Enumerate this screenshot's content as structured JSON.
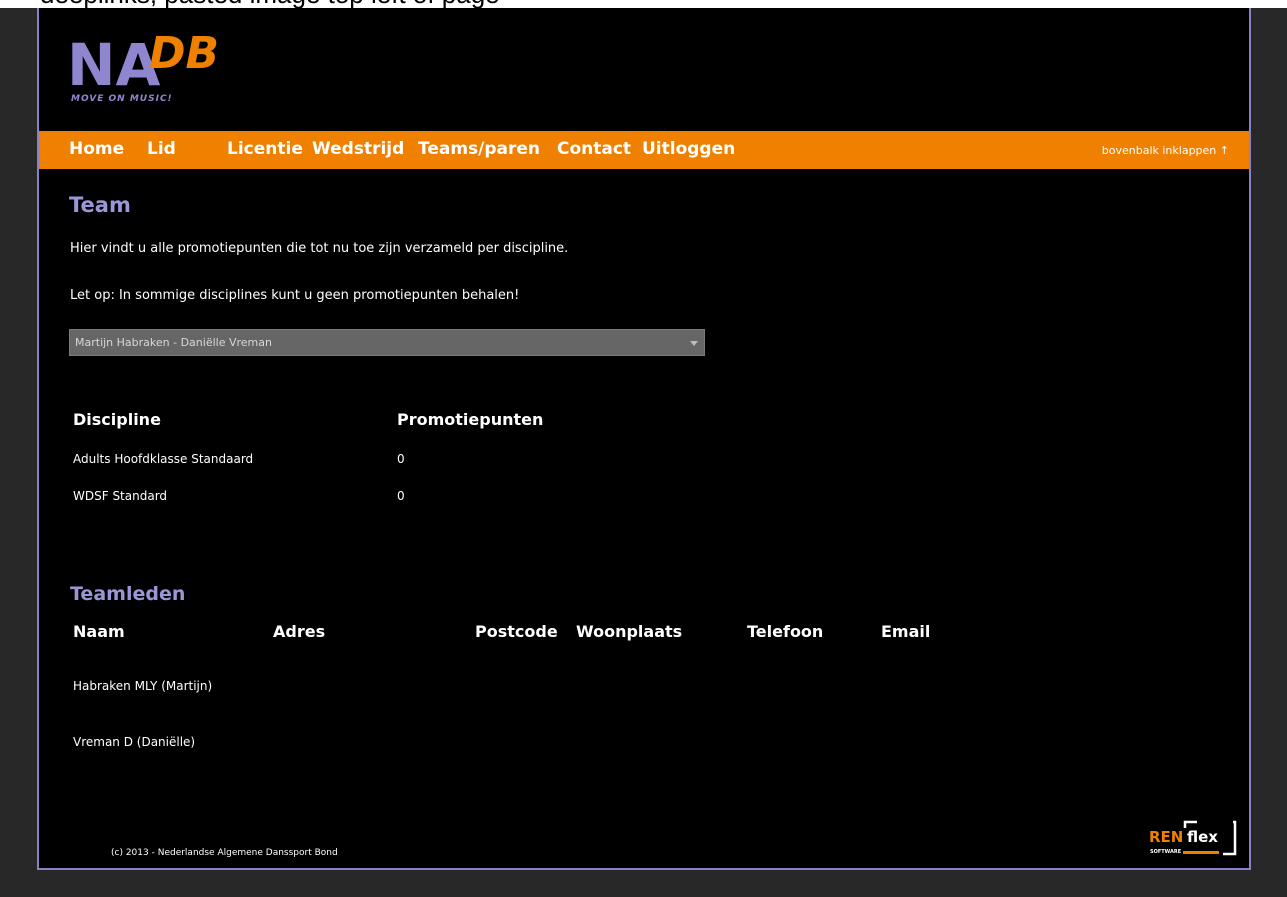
{
  "top_overlay": "deeplinks, pasted image top left of page",
  "logo": {
    "main": "NA",
    "accent": "DB",
    "tagline": "MOVE ON MUSIC!"
  },
  "nav": {
    "items": [
      "Home",
      "Lid",
      "Licentie",
      "Wedstrijd",
      "Teams/paren",
      "Contact",
      "Uitloggen"
    ],
    "collapse": "bovenbalk inklappen ↑"
  },
  "page": {
    "title": "Team",
    "intro": "Hier vindt u alle promotiepunten die tot nu toe zijn verzameld per discipline.",
    "note": "Let op: In sommige disciplines kunt u geen promotiepunten behalen!"
  },
  "team_select": {
    "value": "Martijn Habraken - Daniëlle Vreman"
  },
  "discipline_table": {
    "headers": [
      "Discipline",
      "Promotiepunten"
    ],
    "rows": [
      [
        "Adults Hoofdklasse Standaard",
        "0"
      ],
      [
        "WDSF Standard",
        "0"
      ]
    ]
  },
  "teamleden": {
    "title": "Teamleden",
    "headers": [
      "Naam",
      "Adres",
      "Postcode",
      "Woonplaats",
      "Telefoon",
      "Email"
    ],
    "rows": [
      [
        "Habraken MLY (Martijn)"
      ],
      [
        "Vreman D (Daniëlle)"
      ]
    ]
  },
  "footer": {
    "copyright": "(c) 2013 - Nederlandse Algemene Danssport Bond"
  },
  "vendor_logo": {
    "main": "REN",
    "accent": "flex",
    "sub": "SOFTWARE"
  },
  "colors": {
    "nav_bg": "#f08000",
    "heading": "#9b96d6",
    "frame_border": "#8882c9",
    "background": "#000000",
    "outer_background": "#282828"
  }
}
